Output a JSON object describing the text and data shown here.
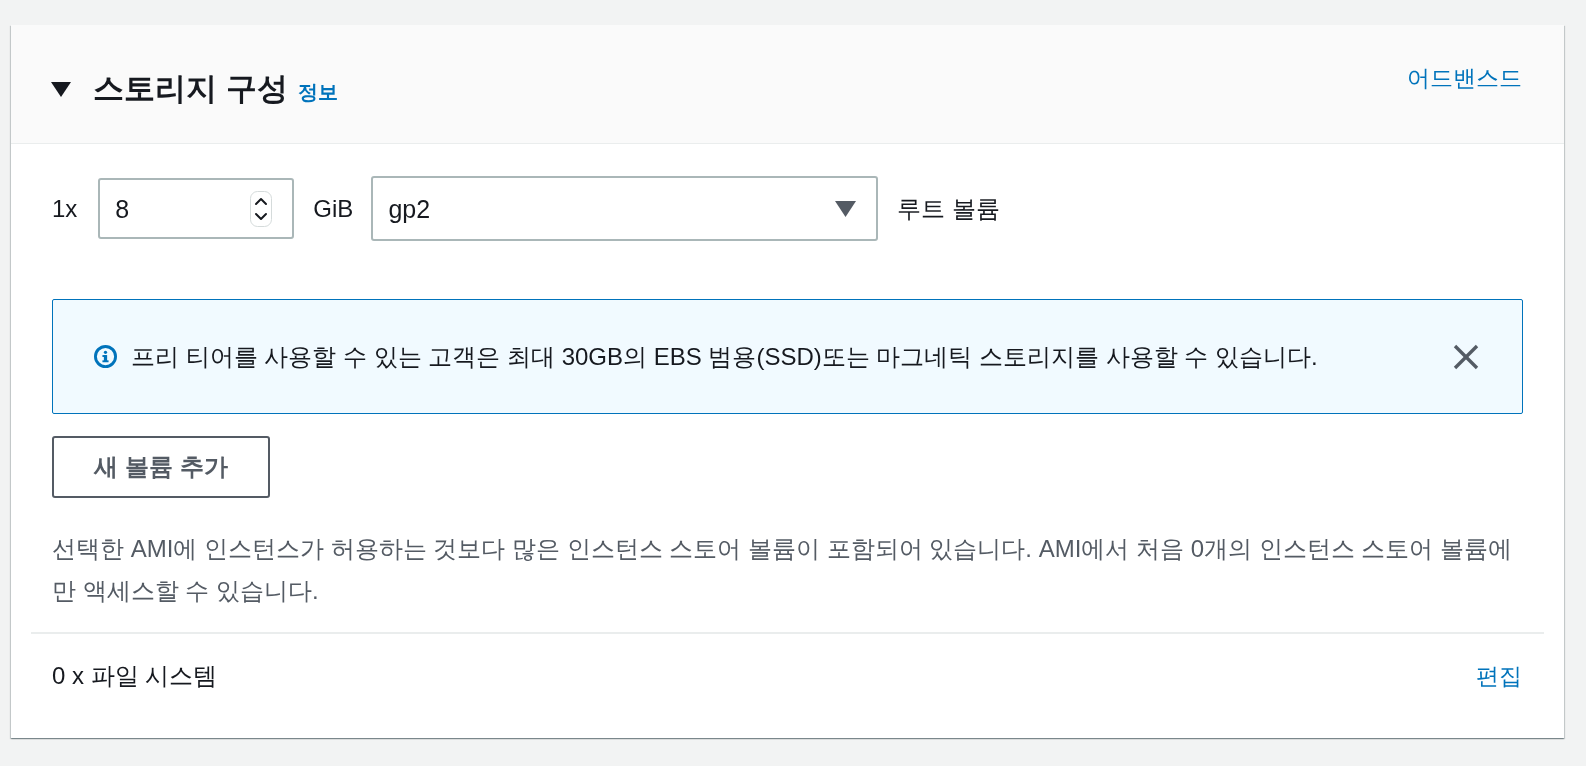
{
  "panel": {
    "expanded": true,
    "title": "스토리지 구성",
    "info_link": "정보",
    "advanced_link": "어드밴스드"
  },
  "volume": {
    "count_label": "1x",
    "size": {
      "value": "8"
    },
    "unit": "GiB",
    "type_select": {
      "value": "gp2"
    },
    "role": "루트 볼륨"
  },
  "alert": {
    "kind": "info",
    "message": "프리 티어를 사용할 수 있는 고객은 최대 30GB의 EBS 범용(SSD)또는 마그네틱 스토리지를 사용할 수 있습니다.",
    "dismissible": true
  },
  "add_button": "새 볼륨 추가",
  "note": "선택한 AMI에 인스턴스가 허용하는 것보다 많은 인스턴스 스토어 볼륨이 포함되어 있습니다. AMI에서 처음 0개의 인스턴스 스토어 볼륨에만 액세스할 수 있습니다.",
  "file_systems": {
    "label": "0 x 파일 시스템",
    "edit_link": "편집"
  }
}
